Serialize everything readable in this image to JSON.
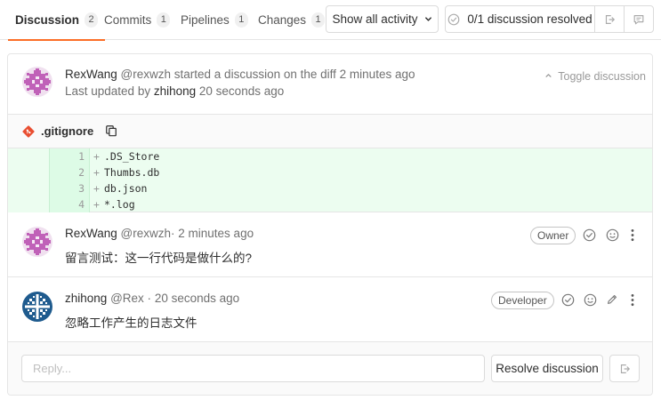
{
  "tabs": [
    {
      "label": "Discussion",
      "count": "2"
    },
    {
      "label": "Commits",
      "count": "1"
    },
    {
      "label": "Pipelines",
      "count": "1"
    },
    {
      "label": "Changes",
      "count": "1"
    }
  ],
  "toolbar": {
    "activity_filter": "Show all activity",
    "resolved_status": "0/1 discussion resolved"
  },
  "discussion": {
    "starter": {
      "author": "RexWang",
      "username": "@rexwzh",
      "action": "started a discussion on the diff",
      "time": "2 minutes ago",
      "updated_prefix": "Last updated by",
      "updated_by": "zhihong",
      "updated_time": "20 seconds ago"
    },
    "toggle_label": "Toggle discussion",
    "file": {
      "name": ".gitignore",
      "lines": [
        {
          "num": "1",
          "sign": "+",
          "text": ".DS_Store"
        },
        {
          "num": "2",
          "sign": "+",
          "text": "Thumbs.db"
        },
        {
          "num": "3",
          "sign": "+",
          "text": "db.json"
        },
        {
          "num": "4",
          "sign": "+",
          "text": "*.log"
        }
      ]
    },
    "notes": [
      {
        "author": "RexWang",
        "username": "@rexwzh",
        "sep": "·",
        "time": "2 minutes ago",
        "role": "Owner",
        "body": "留言测试：这一行代码是做什么的?"
      },
      {
        "author": "zhihong",
        "username": "@Rex",
        "sep": "·",
        "time": "20 seconds ago",
        "role": "Developer",
        "body": "忽略工作产生的日志文件"
      }
    ],
    "reply": {
      "placeholder": "Reply...",
      "resolve_label": "Resolve discussion"
    }
  },
  "colors": {
    "accent": "#fc6d26",
    "added_line_bg": "#ecfdf0",
    "avatar_purple": "#c061b8",
    "avatar_blue": "#1f5b8e"
  }
}
